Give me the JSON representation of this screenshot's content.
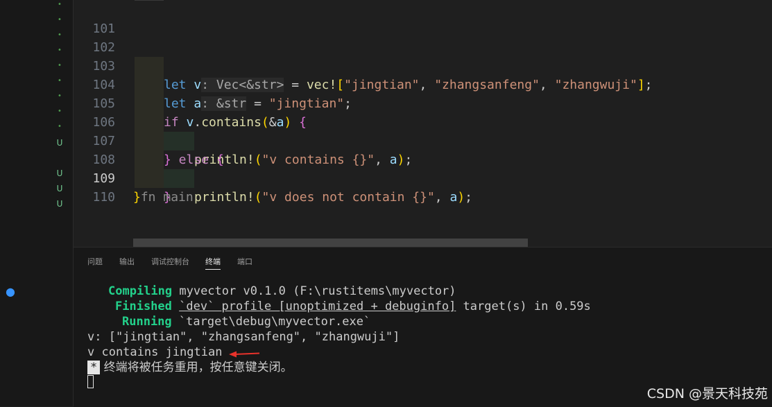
{
  "editor": {
    "line_numbers": [
      "101",
      "102",
      "103",
      "104",
      "105",
      "106",
      "107",
      "108",
      "109",
      "110"
    ],
    "active_line": "109",
    "code": {
      "l102": {
        "kw": "let",
        "var": "v",
        "hint": ": Vec<&str>",
        "eq": " = ",
        "macro": "vec!",
        "open": "[",
        "s1": "\"jingtian\"",
        "c1": ", ",
        "s2": "\"zhangsanfeng\"",
        "c2": ", ",
        "s3": "\"zhangwuji\"",
        "close": "]",
        "end": ";"
      },
      "l103": {
        "kw": "let",
        "var": "a",
        "hint": ": &str",
        "eq": " = ",
        "s1": "\"jingtian\"",
        "end": ";"
      },
      "l104": {
        "kw": "if",
        "var": "v",
        "dot": ".",
        "method": "contains",
        "open": "(",
        "amp": "&",
        "arg": "a",
        "close": ")",
        "brace": " {"
      },
      "l105": {
        "macro": "println!",
        "open": "(",
        "s1": "\"v contains {}\"",
        "c1": ", ",
        "arg": "a",
        "close": ")",
        "end": ";"
      },
      "l106": {
        "brace": "}",
        "kw": " else ",
        "brace2": "{"
      },
      "l107": {
        "macro": "println!",
        "open": "(",
        "s1": "\"v does not contain {}\"",
        "c1": ", ",
        "arg": "a",
        "close": ")",
        "end": ";"
      },
      "l108": {
        "brace": "}"
      },
      "l109": {
        "brace": "}",
        "tail": "fn main"
      }
    }
  },
  "gutter": {
    "dots": [
      "•",
      "•",
      "•",
      "•",
      "•",
      "•",
      "•",
      "•",
      "•"
    ],
    "u": [
      "U",
      "U",
      "U",
      "U"
    ]
  },
  "panel": {
    "tabs": [
      "问题",
      "输出",
      "调试控制台",
      "终端",
      "端口"
    ],
    "active_tab": "终端",
    "terminal": {
      "l1": {
        "label": "Compiling",
        "text": " myvector v0.1.0 (F:\\rustitems\\myvector)"
      },
      "l2": {
        "label": "Finished",
        "text1": " ",
        "u": "`dev` profile [unoptimized + debuginfo]",
        "text2": " target(s) in 0.59s"
      },
      "l3": {
        "label": "Running",
        "text": " `target\\debug\\myvector.exe`"
      },
      "l4": "v: [\"jingtian\", \"zhangsanfeng\", \"zhangwuji\"]",
      "l5": "v contains jingtian",
      "l6_star": "*",
      "l6_text": " 终端将被任务重用，按任意键关闭。"
    }
  },
  "watermark": "CSDN @景天科技苑",
  "colors": {
    "accent": "#3794ff",
    "arrow": "#e8322b",
    "green": "#23d18b"
  }
}
